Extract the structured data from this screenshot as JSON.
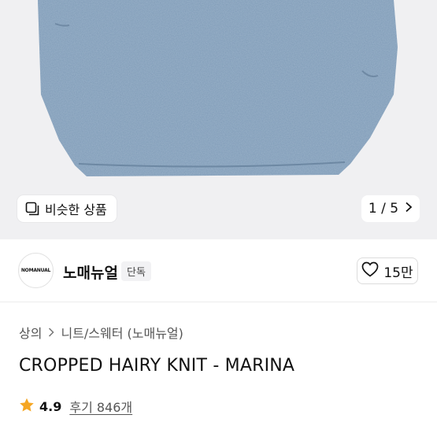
{
  "hero": {
    "similar_label": "비슷한 상품",
    "pager_text": "1 / 5",
    "similar_icon": "similar-items-icon",
    "next_icon": "chevron-right-icon"
  },
  "brand": {
    "logo_text": "NOMANUAL",
    "name": "노매뉴얼",
    "badge": "단독",
    "like_count": "15만",
    "like_icon": "heart-outline-icon"
  },
  "breadcrumb": {
    "level1": "상의",
    "separator_icon": "chevron-right-icon",
    "level2": "니트/스웨터 (노매뉴얼)"
  },
  "product": {
    "title": "CROPPED HAIRY KNIT - MARINA"
  },
  "rating": {
    "star_icon": "star-icon",
    "star_color": "#f5a623",
    "score": "4.9",
    "reviews": "후기 846개"
  },
  "colors": {
    "sweater": "#7f9bb7",
    "hero_bg": "#f0f0f2"
  }
}
